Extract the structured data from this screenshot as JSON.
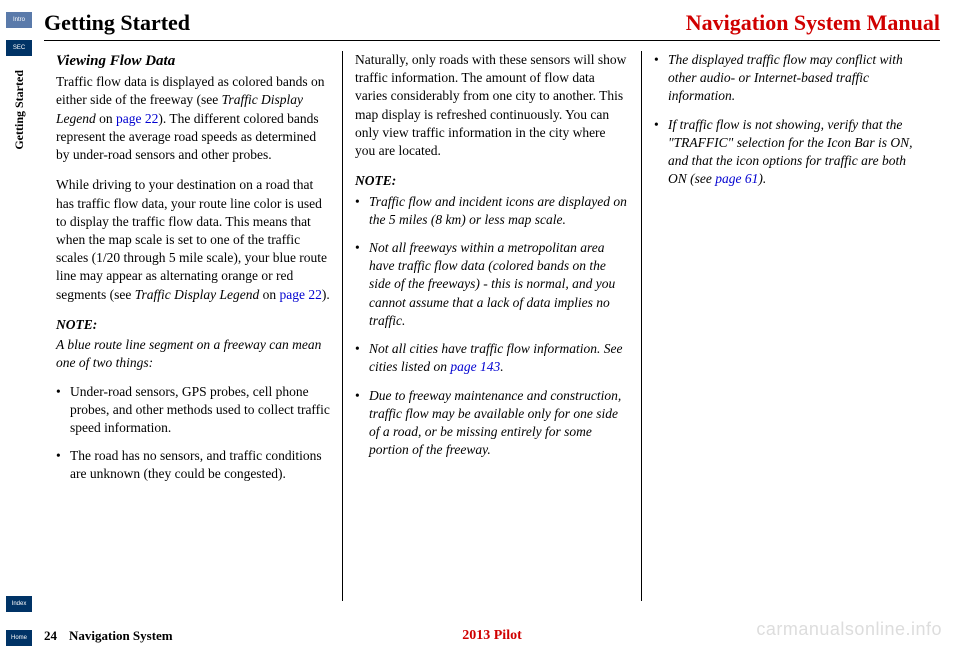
{
  "sidebar": {
    "intro": "Intro",
    "sec": "SEC",
    "vertical": "Getting Started",
    "index": "Index",
    "home": "Home"
  },
  "header": {
    "left": "Getting Started",
    "right": "Navigation System Manual"
  },
  "col1": {
    "heading": "Viewing Flow Data",
    "p1a": "Traffic flow data is displayed as colored bands on either side of the freeway (see ",
    "p1ref": "Traffic Display Legend",
    "p1on": " on ",
    "p1link": "page 22",
    "p1b": "). The different colored bands represent the average road speeds as determined by under-road sensors and other probes.",
    "p2a": "While driving to your destination on a road that has traffic flow data, your route line color is used to display the traffic flow data. This means that when the map scale is set to one of the traffic scales (1/20 through 5 mile scale), your blue route line may appear as alternating orange or red segments (see ",
    "p2ref": "Traffic Display Legend",
    "p2on": " on ",
    "p2link": "page 22",
    "p2b": ").",
    "note_label": "NOTE:",
    "note_text": "A blue route line segment on a freeway can mean one of two things:",
    "bullets": [
      {
        "text": "Under-road sensors, GPS probes, cell phone probes, and other methods used to collect traffic speed information."
      },
      {
        "text": "The road has no sensors, and traffic conditions are unknown (they could be congested)."
      }
    ]
  },
  "col2": {
    "p1": "Naturally, only roads with these sensors will show traffic information. The amount of flow data varies considerably from one city to another. This map display is refreshed continuously. You can only view traffic information in the city where you are located.",
    "note_label": "NOTE:",
    "bullets": [
      {
        "text": "Traffic flow and incident icons are displayed on the 5 miles (8 km) or less map scale."
      },
      {
        "text": "Not all freeways within a metropolitan area have traffic flow data (colored bands on the side of the freeways) - this is normal, and you cannot assume that a lack of data implies no traffic."
      },
      {
        "text_a": "Not all cities have traffic flow information. See cities listed on ",
        "link": "page 143",
        "text_b": "."
      },
      {
        "text": "Due to freeway maintenance and construction, traffic flow may be available only for one side of a road, or be missing entirely for some portion of the freeway."
      }
    ]
  },
  "col3": {
    "bullets": [
      {
        "text": "The displayed traffic flow may conflict with other audio- or Internet-based traffic information."
      },
      {
        "text_a": "If traffic flow is not showing, verify that the \"TRAFFIC\" selection for the Icon Bar is ON, and that the icon options for traffic are both ON (see ",
        "link": "page 61",
        "text_b": ")."
      }
    ]
  },
  "footer": {
    "page": "24",
    "title": "Navigation System",
    "model": "2013 Pilot"
  },
  "watermark": "carmanualsonline.info"
}
